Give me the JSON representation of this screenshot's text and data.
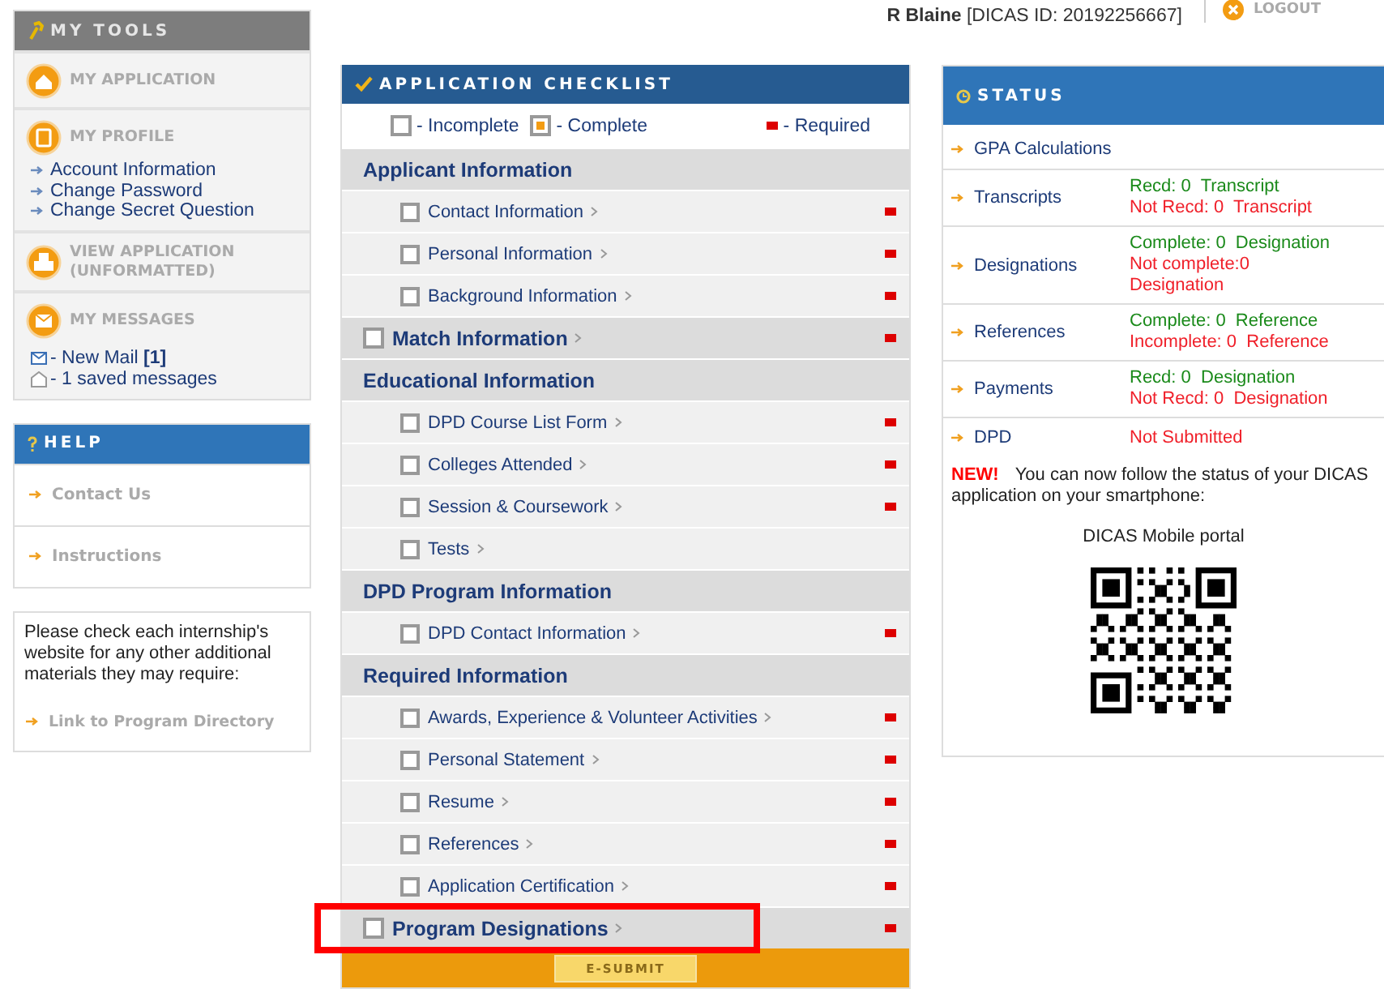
{
  "user_bar": {
    "user_name": "R Blaine",
    "user_id": "[DICAS ID: 20192256667]",
    "logout": "LOGOUT"
  },
  "my_tools": {
    "title": "MY TOOLS",
    "sections": [
      {
        "title": "MY APPLICATION"
      },
      {
        "title": "MY PROFILE",
        "links": [
          "Account Information",
          "Change Password",
          "Change Secret Question"
        ]
      },
      {
        "title": "VIEW APPLICATION (UNFORMATTED)"
      },
      {
        "title": "MY MESSAGES",
        "messages": [
          {
            "kind": "mail",
            "text": "- New Mail **[1]**"
          },
          {
            "kind": "saved",
            "text": "- 1 saved messages"
          }
        ]
      }
    ]
  },
  "help": {
    "title": "HELP",
    "links": [
      "Contact Us",
      "Instructions"
    ]
  },
  "note": {
    "text": "Please check each internship's website for any other additional materials they may require:",
    "link": "Link to Program Directory"
  },
  "checklist": {
    "title": "APPLICATION CHECKLIST",
    "legend": {
      "incomplete": "- Incomplete",
      "complete": "- Complete",
      "required": "- Required"
    },
    "rows": [
      {
        "kind": "section",
        "label": "Applicant Information"
      },
      {
        "kind": "item",
        "label": "Contact Information",
        "checked": false,
        "required": true,
        "highlighted": false
      },
      {
        "kind": "item",
        "label": "Personal Information",
        "checked": false,
        "required": true,
        "highlighted": false
      },
      {
        "kind": "item",
        "label": "Background Information",
        "checked": false,
        "required": true,
        "highlighted": false
      },
      {
        "kind": "top_item",
        "label": "Match Information",
        "checked": false,
        "required": true,
        "highlighted": false
      },
      {
        "kind": "section",
        "label": "Educational Information"
      },
      {
        "kind": "item",
        "label": "DPD Course List Form",
        "checked": false,
        "required": true,
        "highlighted": false
      },
      {
        "kind": "item",
        "label": "Colleges Attended",
        "checked": false,
        "required": true,
        "highlighted": false
      },
      {
        "kind": "item",
        "label": "Session & Coursework",
        "checked": false,
        "required": true,
        "highlighted": false
      },
      {
        "kind": "item",
        "label": "Tests",
        "checked": false,
        "required": false,
        "highlighted": false
      },
      {
        "kind": "section",
        "label": "DPD Program Information"
      },
      {
        "kind": "item",
        "label": "DPD Contact Information",
        "checked": false,
        "required": true,
        "highlighted": false
      },
      {
        "kind": "section",
        "label": "Required Information"
      },
      {
        "kind": "item",
        "label": "Awards, Experience & Volunteer Activities",
        "checked": false,
        "required": true,
        "highlighted": false
      },
      {
        "kind": "item",
        "label": "Personal Statement",
        "checked": false,
        "required": true,
        "highlighted": false
      },
      {
        "kind": "item",
        "label": "Resume",
        "checked": false,
        "required": true,
        "highlighted": false
      },
      {
        "kind": "item",
        "label": "References",
        "checked": false,
        "required": true,
        "highlighted": false
      },
      {
        "kind": "item",
        "label": "Application Certification",
        "checked": false,
        "required": true,
        "highlighted": false
      },
      {
        "kind": "top_item",
        "label": "Program Designations",
        "checked": false,
        "required": true,
        "highlighted": true
      }
    ],
    "submit": "E-SUBMIT"
  },
  "status": {
    "title": "STATUS",
    "rows": [
      {
        "label": "GPA Calculations"
      },
      {
        "label": "Transcripts",
        "lines": [
          {
            "kind": "ok",
            "text": "Recd: 0  Transcript"
          },
          {
            "kind": "bad",
            "text": "Not Recd: 0  Transcript"
          }
        ]
      },
      {
        "label": "Designations",
        "lines": [
          {
            "kind": "ok",
            "text": "Complete: 0  Designation"
          },
          {
            "kind": "bad",
            "text": "Not complete:0 Designation"
          }
        ]
      },
      {
        "label": "References",
        "lines": [
          {
            "kind": "ok",
            "text": "Complete: 0  Reference"
          },
          {
            "kind": "bad",
            "text": "Incomplete: 0  Reference"
          }
        ]
      },
      {
        "label": "Payments",
        "lines": [
          {
            "kind": "ok",
            "text": "Recd: 0  Designation"
          },
          {
            "kind": "bad",
            "text": "Not Recd: 0  Designation"
          }
        ]
      },
      {
        "label": "DPD",
        "lines": [
          {
            "kind": "bad",
            "text": "Not Submitted"
          }
        ]
      }
    ],
    "notice": {
      "badge": "NEW!",
      "text": "You can now follow the status of your DICAS application on your smartphone:"
    },
    "portal": "DICAS Mobile portal"
  }
}
